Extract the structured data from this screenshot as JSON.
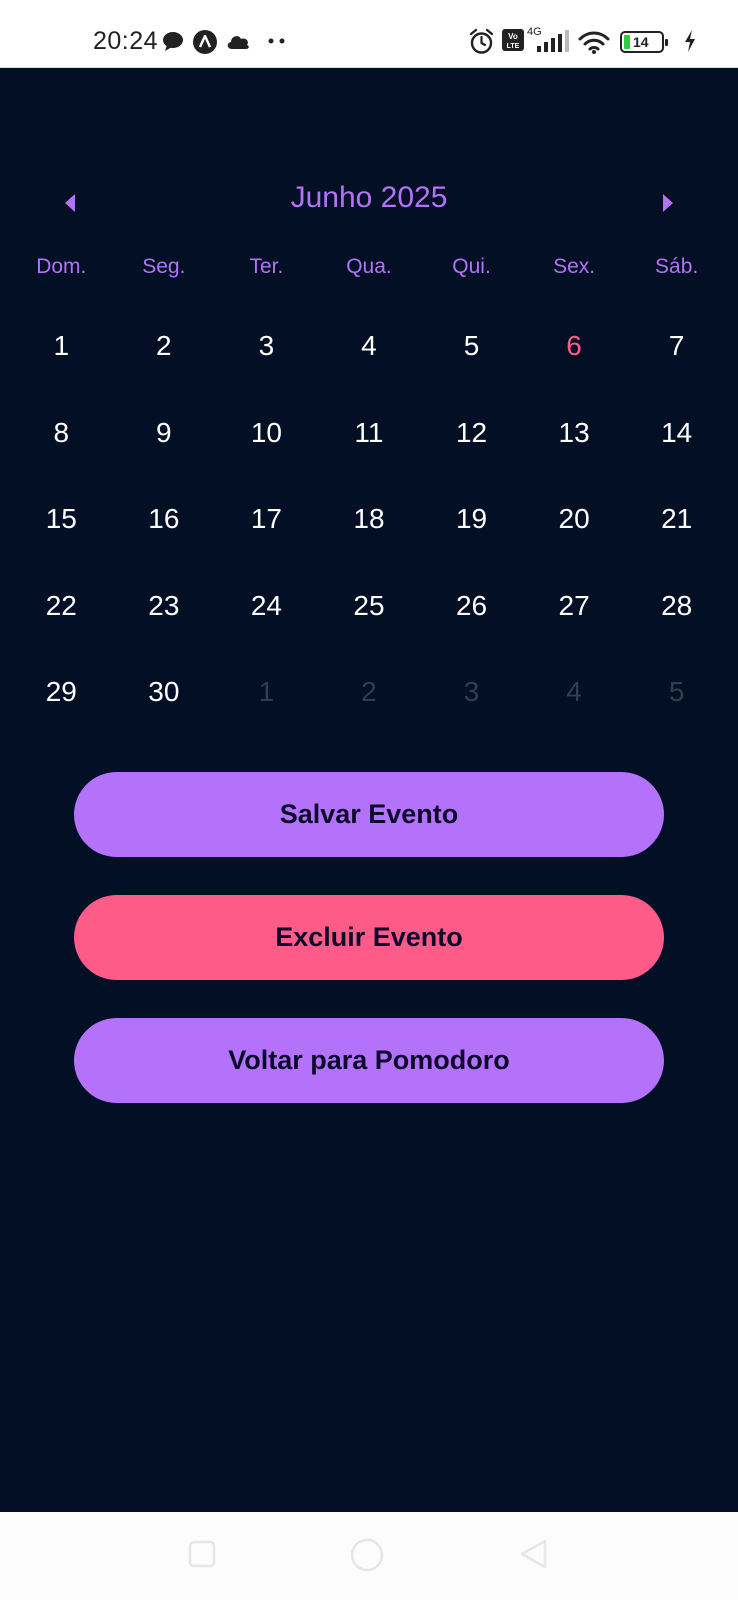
{
  "status_bar": {
    "time": "20:24",
    "network_label": "4G",
    "volte_label": "Vo LTE",
    "battery_level": "14",
    "icons": [
      "chat-bubble-icon",
      "navigation-a-icon",
      "cloud-icon",
      "more-dots-icon",
      "alarm-icon",
      "volte-icon",
      "signal-icon",
      "wifi-icon",
      "battery-icon",
      "charging-icon"
    ]
  },
  "calendar": {
    "month_title": "Junho 2025",
    "prev_icon": "caret-left-icon",
    "next_icon": "caret-right-icon",
    "weekdays": [
      "Dom.",
      "Seg.",
      "Ter.",
      "Qua.",
      "Qui.",
      "Sex.",
      "Sáb."
    ],
    "days": [
      {
        "n": "1"
      },
      {
        "n": "2"
      },
      {
        "n": "3"
      },
      {
        "n": "4"
      },
      {
        "n": "5"
      },
      {
        "n": "6",
        "today": true
      },
      {
        "n": "7"
      },
      {
        "n": "8"
      },
      {
        "n": "9"
      },
      {
        "n": "10"
      },
      {
        "n": "11"
      },
      {
        "n": "12"
      },
      {
        "n": "13"
      },
      {
        "n": "14"
      },
      {
        "n": "15"
      },
      {
        "n": "16"
      },
      {
        "n": "17"
      },
      {
        "n": "18"
      },
      {
        "n": "19"
      },
      {
        "n": "20"
      },
      {
        "n": "21"
      },
      {
        "n": "22"
      },
      {
        "n": "23"
      },
      {
        "n": "24"
      },
      {
        "n": "25"
      },
      {
        "n": "26"
      },
      {
        "n": "27"
      },
      {
        "n": "28"
      },
      {
        "n": "29"
      },
      {
        "n": "30"
      },
      {
        "n": "1",
        "other_month": true
      },
      {
        "n": "2",
        "other_month": true
      },
      {
        "n": "3",
        "other_month": true
      },
      {
        "n": "4",
        "other_month": true
      },
      {
        "n": "5",
        "other_month": true
      }
    ]
  },
  "buttons": {
    "save_label": "Salvar Evento",
    "delete_label": "Excluir Evento",
    "back_label": "Voltar para Pomodoro"
  },
  "colors": {
    "background": "#020f24",
    "accent_purple": "#b472fb",
    "accent_pink": "#ff5b89",
    "text_white": "#ffffff",
    "muted_day": "#333d4d"
  },
  "nav_bar": {
    "icons": [
      "recents-square-icon",
      "home-circle-icon",
      "back-triangle-icon"
    ]
  }
}
